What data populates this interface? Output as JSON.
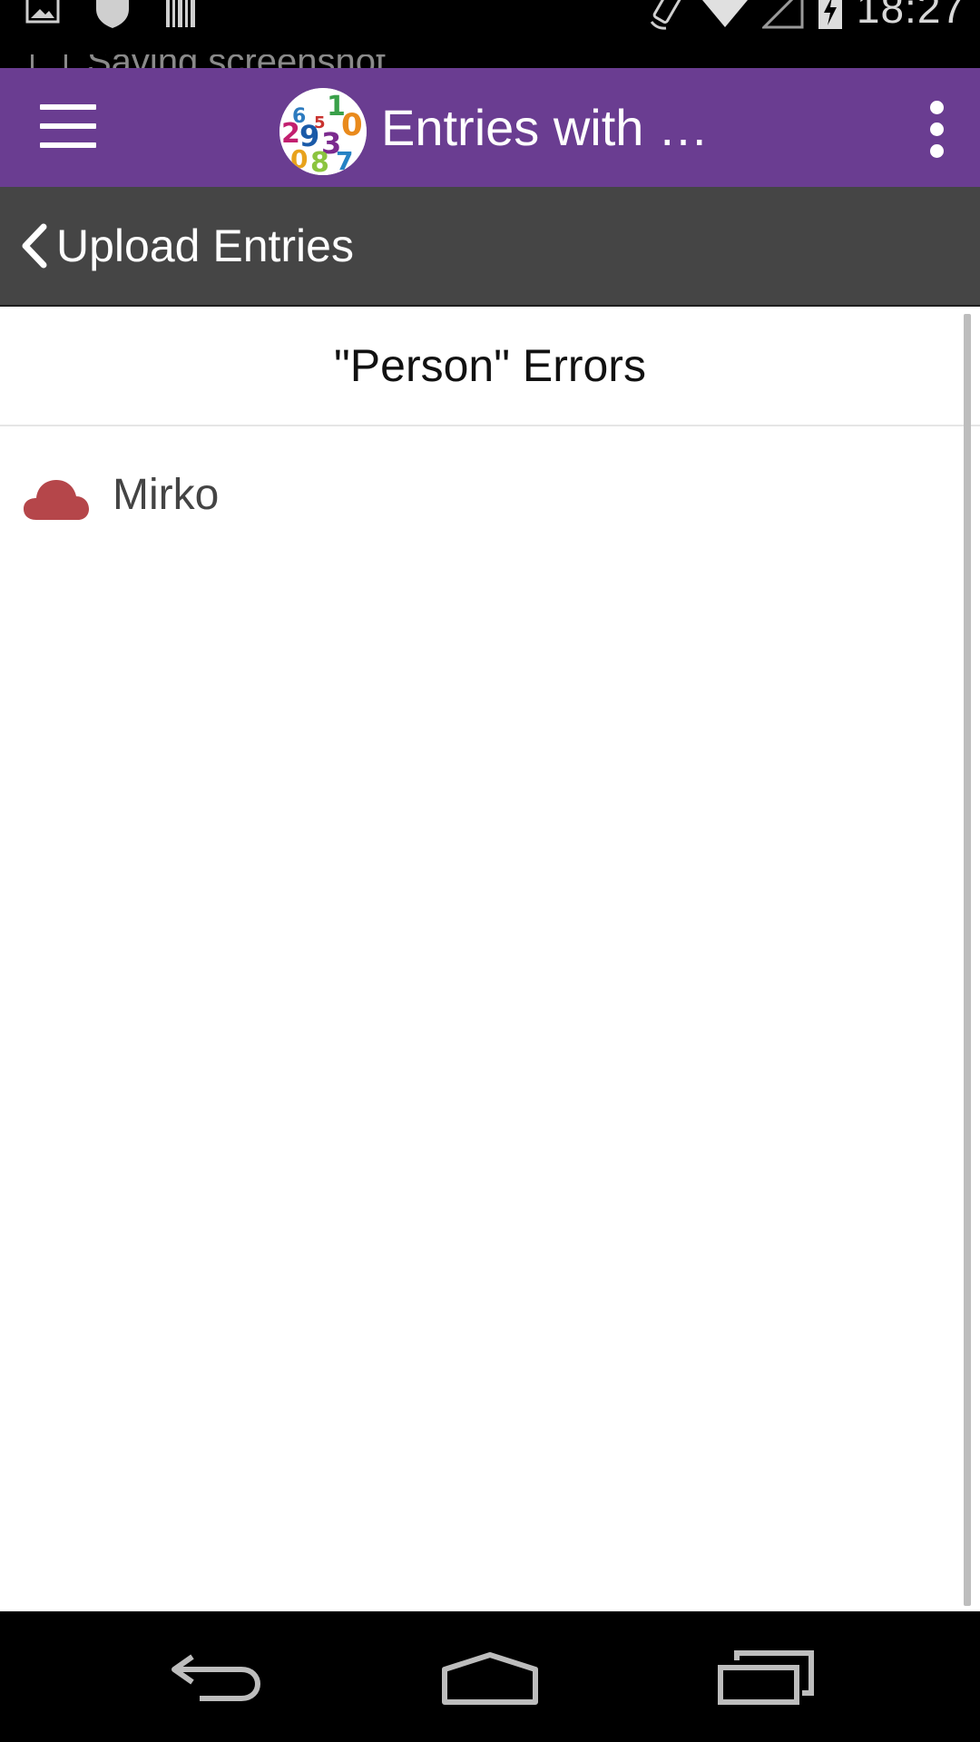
{
  "status_bar": {
    "time": "18:27",
    "notification_text": "Saving screenshot",
    "icons": [
      "gallery-icon",
      "shield-icon",
      "barcode-icon",
      "rotate-icon",
      "wifi-icon",
      "signal-icon",
      "battery-charging-icon"
    ]
  },
  "app_bar": {
    "title": "Entries with …",
    "logo": "numbers-logo",
    "accent_color": "#6a3d91"
  },
  "sub_bar": {
    "back_label": "Upload Entries"
  },
  "section": {
    "title": "\"Person\" Errors"
  },
  "list": {
    "items": [
      {
        "label": "Mirko",
        "icon": "cloud-icon",
        "icon_color": "#b5464a"
      }
    ]
  },
  "nav_bar": {
    "buttons": [
      "back-nav-icon",
      "home-nav-icon",
      "recents-nav-icon"
    ]
  }
}
